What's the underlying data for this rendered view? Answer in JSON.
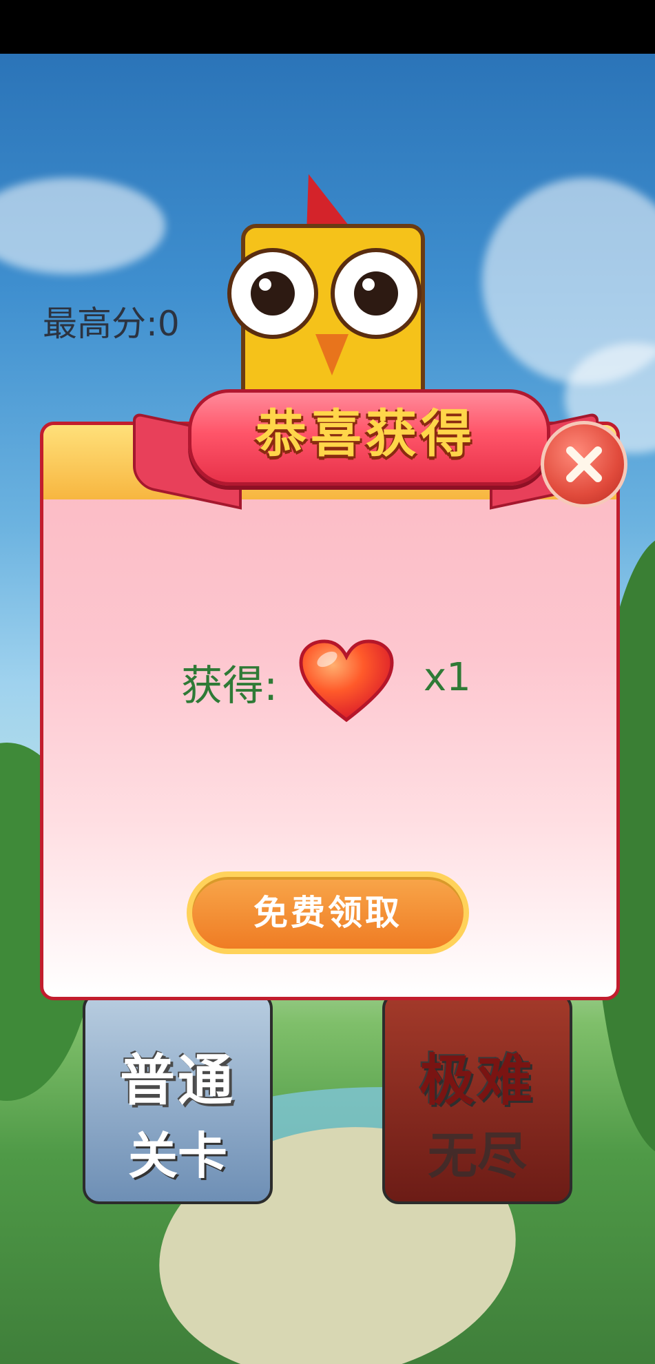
{
  "hud": {
    "high_score_text": "最高分:0"
  },
  "modes": [
    {
      "title": "普通",
      "subtitle": "关卡"
    },
    {
      "title": "极难",
      "subtitle": "无尽"
    }
  ],
  "dialog": {
    "title": "恭喜获得",
    "reward_label": "获得:",
    "reward_icon": "heart-icon",
    "reward_quantity": "x1",
    "claim_button_label": "免费领取",
    "close_icon": "close-icon"
  },
  "colors": {
    "dialog_border": "#c21d2d",
    "reward_text": "#2f7a36",
    "claim_button": "#ef7c24",
    "ribbon": "#e8324a"
  }
}
